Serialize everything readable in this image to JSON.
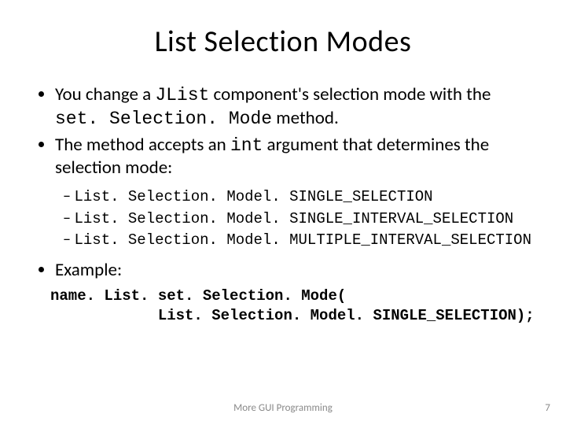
{
  "title": "List Selection Modes",
  "bullets": {
    "b1_pre": "You change a ",
    "b1_code": "JList",
    "b1_mid": " component's selection mode with the ",
    "b1_code2": "set. Selection. Mode",
    "b1_post": " method.",
    "b2_pre": "The method accepts an ",
    "b2_code": "int",
    "b2_post": " argument that determines the selection mode:",
    "sub1": "List. Selection. Model. SINGLE_SELECTION",
    "sub2": "List. Selection. Model. SINGLE_INTERVAL_SELECTION",
    "sub3": "List. Selection. Model. MULTIPLE_INTERVAL_SELECTION",
    "b3": "Example:"
  },
  "code": {
    "line1": "name. List. set. Selection. Mode(",
    "line2": "            List. Selection. Model. SINGLE_SELECTION);"
  },
  "footer": "More GUI Programming",
  "page": "7"
}
